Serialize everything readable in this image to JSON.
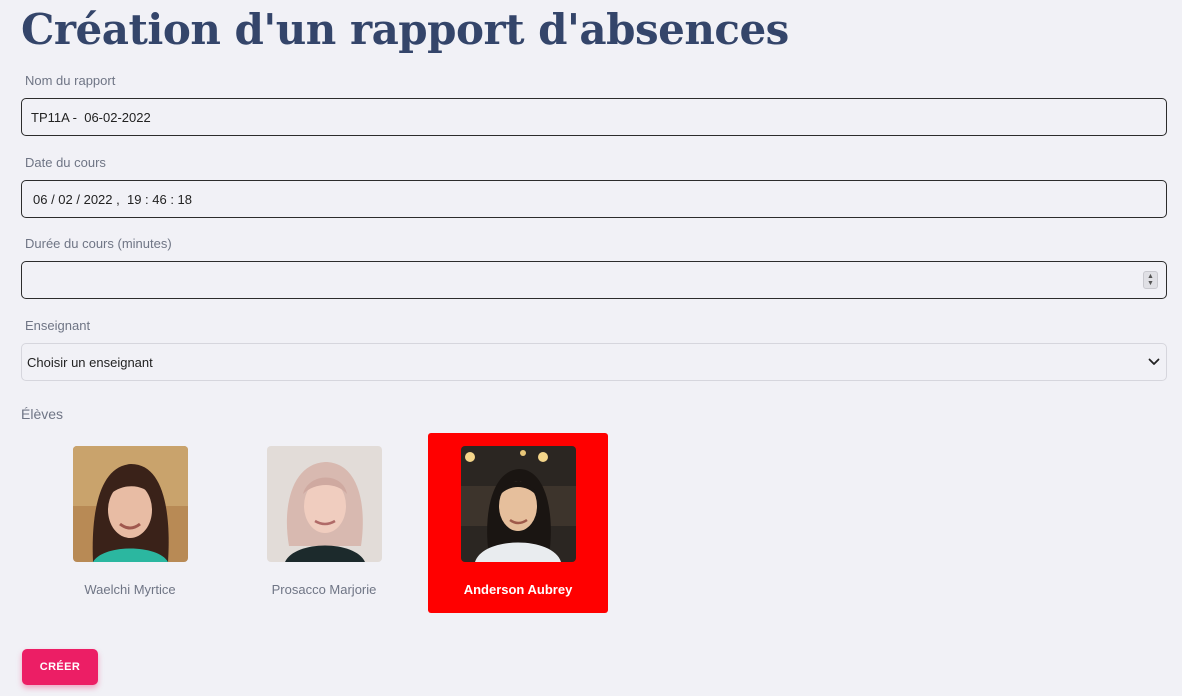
{
  "page": {
    "title": "Création d'un rapport d'absences"
  },
  "form": {
    "report_name": {
      "label": "Nom du rapport",
      "value": "TP11A -  06-02-2022"
    },
    "course_date": {
      "label": "Date du cours",
      "value": "06 / 02 / 2022 ,  19 : 46 : 18"
    },
    "course_duration": {
      "label": "Durée du cours (minutes)",
      "value": ""
    },
    "teacher": {
      "label": "Enseignant",
      "selected": "Choisir un enseignant"
    }
  },
  "students": {
    "label": "Élèves",
    "items": [
      {
        "name": "Waelchi Myrtice",
        "selected": false
      },
      {
        "name": "Prosacco Marjorie",
        "selected": false
      },
      {
        "name": "Anderson Aubrey",
        "selected": true
      }
    ]
  },
  "actions": {
    "create_label": "CRÉER"
  },
  "colors": {
    "title": "#34456a",
    "selected_card": "#ff0000",
    "primary_button": "#ec1e65",
    "background": "#f1f1f6"
  },
  "icons": {
    "select": "chevron-down-icon",
    "spinner": "number-spinner-icon"
  }
}
